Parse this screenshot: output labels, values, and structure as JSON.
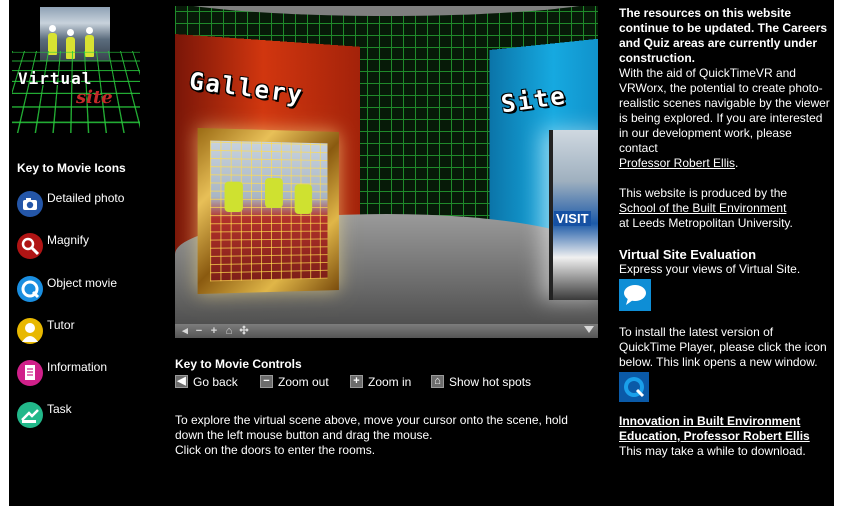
{
  "logo": {
    "word1": "Virtual",
    "word2": "site"
  },
  "icon_key": {
    "title": "Key to Movie Icons",
    "items": [
      {
        "label": "Detailed photo",
        "icon": "camera-icon",
        "color": "#2456a8"
      },
      {
        "label": "Magnify",
        "icon": "magnify-icon",
        "color": "#b01414"
      },
      {
        "label": "Object movie",
        "icon": "object-movie-icon",
        "color": "#1a8ee0"
      },
      {
        "label": "Tutor",
        "icon": "tutor-icon",
        "color": "#e8b800"
      },
      {
        "label": "Information",
        "icon": "information-icon",
        "color": "#d0208a"
      },
      {
        "label": "Task",
        "icon": "task-icon",
        "color": "#22b88a"
      }
    ]
  },
  "panorama": {
    "gallery_sign": "Gallery",
    "site_sign": "Site",
    "visit_text": "VISIT"
  },
  "movie_controls": {
    "title": "Key to Movie Controls",
    "items": [
      {
        "label": "Go back",
        "icon": "go-back-icon",
        "glyph": "◀"
      },
      {
        "label": "Zoom out",
        "icon": "zoom-out-icon",
        "glyph": "−"
      },
      {
        "label": "Zoom in",
        "icon": "zoom-in-icon",
        "glyph": "+"
      },
      {
        "label": "Show hot spots",
        "icon": "hot-spots-icon",
        "glyph": "⌂"
      }
    ]
  },
  "instructions": {
    "line1": "To explore the virtual scene above, move your cursor onto the scene, hold",
    "line2": "down the left mouse button and drag the mouse.",
    "line3": "Click on the doors to enter the rooms."
  },
  "right": {
    "notice": "The resources on this website continue to be updated. The Careers and Quiz areas are currently under construction.",
    "intro": "With the aid of QuickTimeVR and VRWorx, the potential to create photo-realistic scenes navigable by the viewer is being explored. If you are interested in our development work, please contact",
    "contact_link": "Professor Robert Ellis",
    "produced_prefix": "This website is produced by the",
    "school_link": "School of the Built Environment",
    "produced_suffix": "at Leeds Metropolitan University.",
    "eval_title": "Virtual Site Evaluation",
    "eval_text": "Express your views of Virtual Site.",
    "install_text": "To install the latest version of QuickTime Player, please click the icon below. This link opens a new window.",
    "innovation_link": "Innovation in Built Environment Education, Professor Robert Ellis",
    "download_note": "This may take a while to download."
  }
}
